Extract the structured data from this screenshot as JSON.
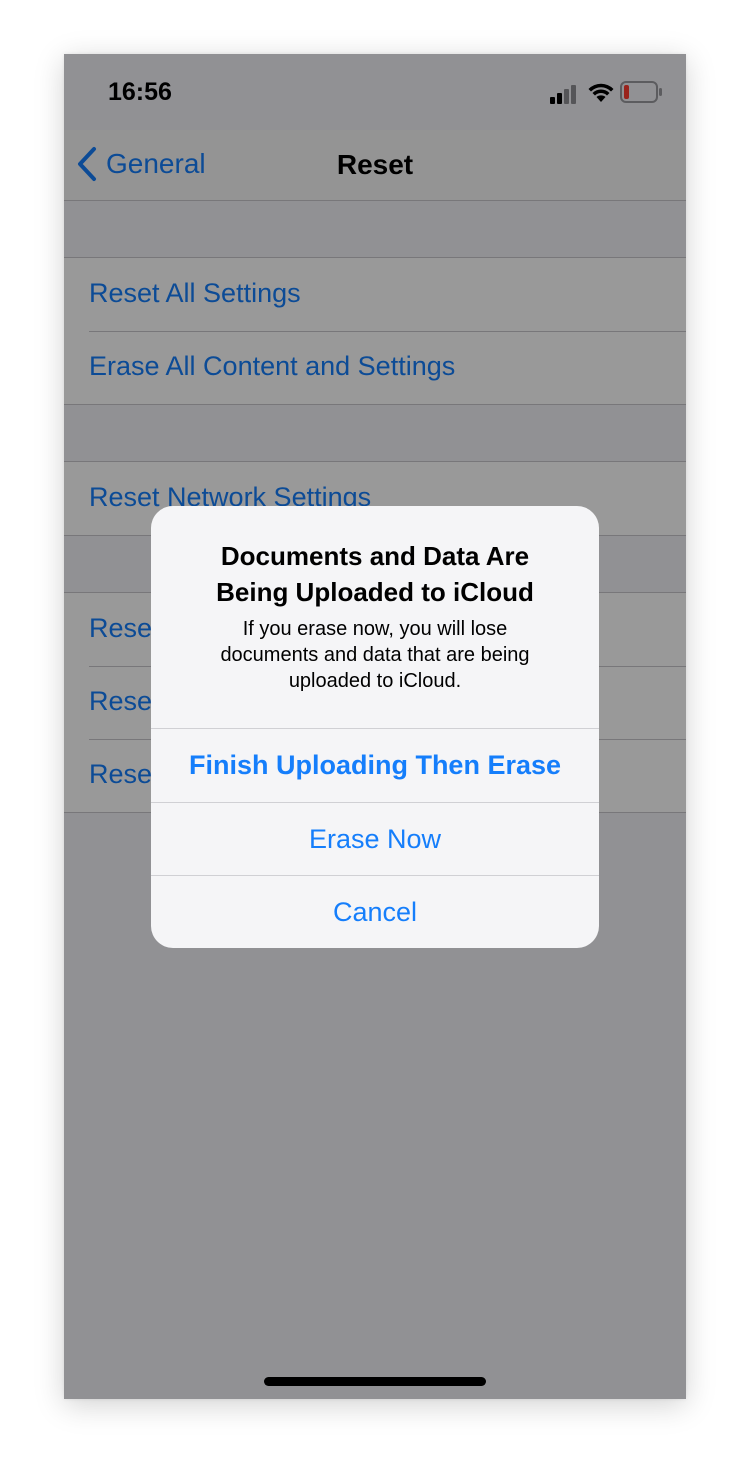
{
  "status_bar": {
    "time": "16:56",
    "icons": [
      "cellular-signal-icon",
      "wifi-icon",
      "battery-low-icon"
    ]
  },
  "navbar": {
    "back_label": "General",
    "title": "Reset"
  },
  "list": {
    "group1": [
      "Reset All Settings",
      "Erase All Content and Settings"
    ],
    "group2": [
      "Reset Network Settings"
    ],
    "group3": [
      "Rese",
      "Rese",
      "Rese"
    ]
  },
  "alert": {
    "title_line1": "Documents and Data Are",
    "title_line2": "Being Uploaded to iCloud",
    "message_line1": "If you erase now, you will lose",
    "message_line2": "documents and data that are being",
    "message_line3": "uploaded to iCloud.",
    "buttons": {
      "finish": "Finish Uploading Then Erase",
      "erase_now": "Erase Now",
      "cancel": "Cancel"
    }
  },
  "colors": {
    "accent": "#157efb",
    "background": "#f2f2f7",
    "battery_low": "#ff3b30"
  }
}
